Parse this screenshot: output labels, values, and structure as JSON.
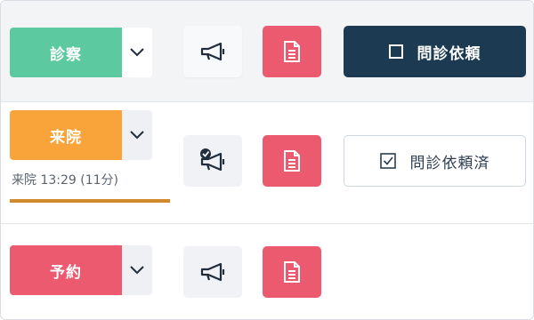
{
  "colors": {
    "consult_green": "#5cc9a0",
    "visited_orange": "#f9a43a",
    "reserved_red": "#ec5a6f",
    "request_navy": "#1c3a52",
    "progress_bar": "#d08a2a"
  },
  "rows": [
    {
      "status_label": "診察",
      "request": {
        "label": "問診依頼",
        "state": "unchecked"
      }
    },
    {
      "status_label": "来院",
      "visit_info": "来院 13:29 (11分)",
      "request": {
        "label": "問診依頼済",
        "state": "checked"
      }
    },
    {
      "status_label": "予約"
    }
  ],
  "icons": {
    "caret": "chevron-down-icon",
    "announce": "megaphone-icon",
    "announce_done": "megaphone-checked-icon",
    "document": "document-icon",
    "checkbox_empty": "checkbox-empty-icon",
    "checkbox_checked": "checkbox-checked-icon"
  }
}
